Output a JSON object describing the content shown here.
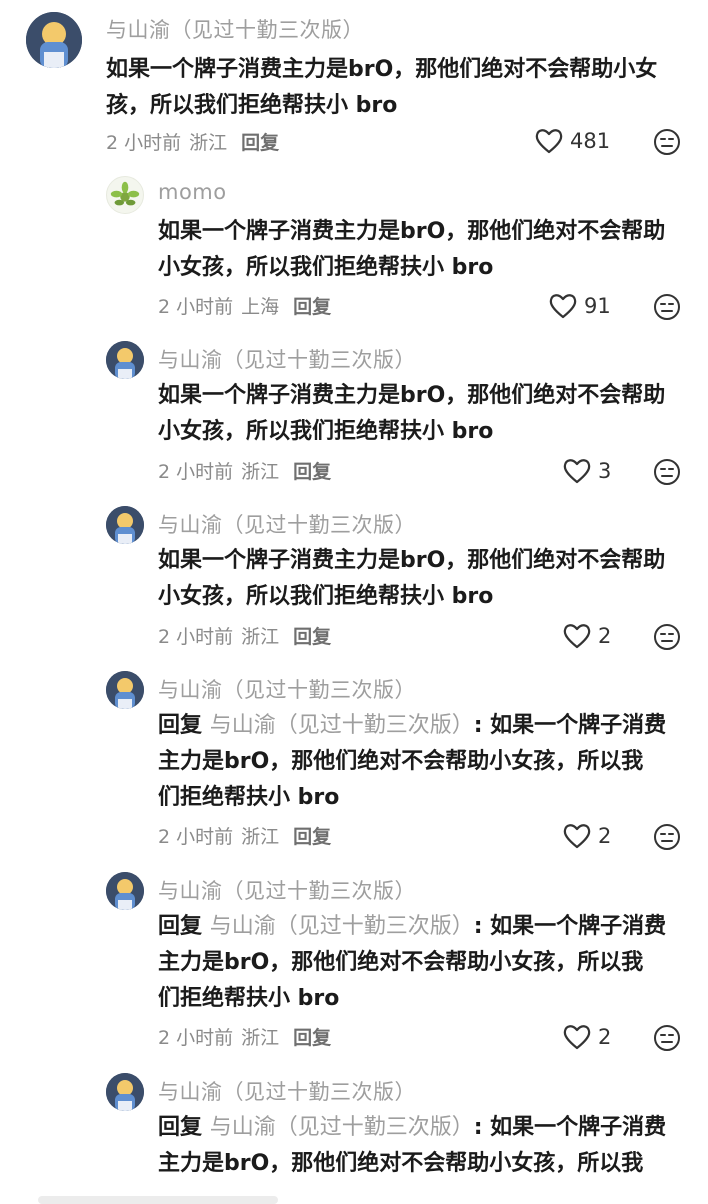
{
  "comments": [
    {
      "user": "与山渝（见过十勤三次版）",
      "text": "如果一个牌子消费主力是brO，那他们绝对不会帮助小女\n孩，所以我们拒绝帮扶小 bro",
      "time": "2 小时前",
      "location": "浙江",
      "reply_label": "回复",
      "likes": "481"
    },
    {
      "user": "momo",
      "text": "如果一个牌子消费主力是brO，那他们绝对不会帮助\n小女孩，所以我们拒绝帮扶小 bro",
      "time": "2 小时前",
      "location": "上海",
      "reply_label": "回复",
      "likes": "91"
    },
    {
      "user": "与山渝（见过十勤三次版）",
      "text": "如果一个牌子消费主力是brO，那他们绝对不会帮助\n小女孩，所以我们拒绝帮扶小 bro",
      "time": "2 小时前",
      "location": "浙江",
      "reply_label": "回复",
      "likes": "3"
    },
    {
      "user": "与山渝（见过十勤三次版）",
      "text": "如果一个牌子消费主力是brO，那他们绝对不会帮助\n小女孩，所以我们拒绝帮扶小 bro",
      "time": "2 小时前",
      "location": "浙江",
      "reply_label": "回复",
      "likes": "2"
    },
    {
      "user": "与山渝（见过十勤三次版）",
      "reply_word": "回复",
      "reply_target": "与山渝（见过十勤三次版）",
      "text": ": 如果一个牌子消费\n主力是brO，那他们绝对不会帮助小女孩，所以我\n们拒绝帮扶小 bro",
      "time": "2 小时前",
      "location": "浙江",
      "reply_label": "回复",
      "likes": "2"
    },
    {
      "user": "与山渝（见过十勤三次版）",
      "reply_word": "回复",
      "reply_target": "与山渝（见过十勤三次版）",
      "text": ": 如果一个牌子消费\n主力是brO，那他们绝对不会帮助小女孩，所以我\n们拒绝帮扶小 bro",
      "time": "2 小时前",
      "location": "浙江",
      "reply_label": "回复",
      "likes": "2"
    },
    {
      "user": "与山渝（见过十勤三次版）",
      "reply_word": "回复",
      "reply_target": "与山渝（见过十勤三次版）",
      "text": ": 如果一个牌子消费\n主力是brO，那他们绝对不会帮助小女孩，所以我"
    }
  ],
  "icons": {
    "like": "heart-outline-icon",
    "dislike": "neutral-face-icon"
  },
  "colors": {
    "username": "#9e9e9e",
    "text": "#1b1b1b",
    "meta": "#8a8a8a"
  }
}
